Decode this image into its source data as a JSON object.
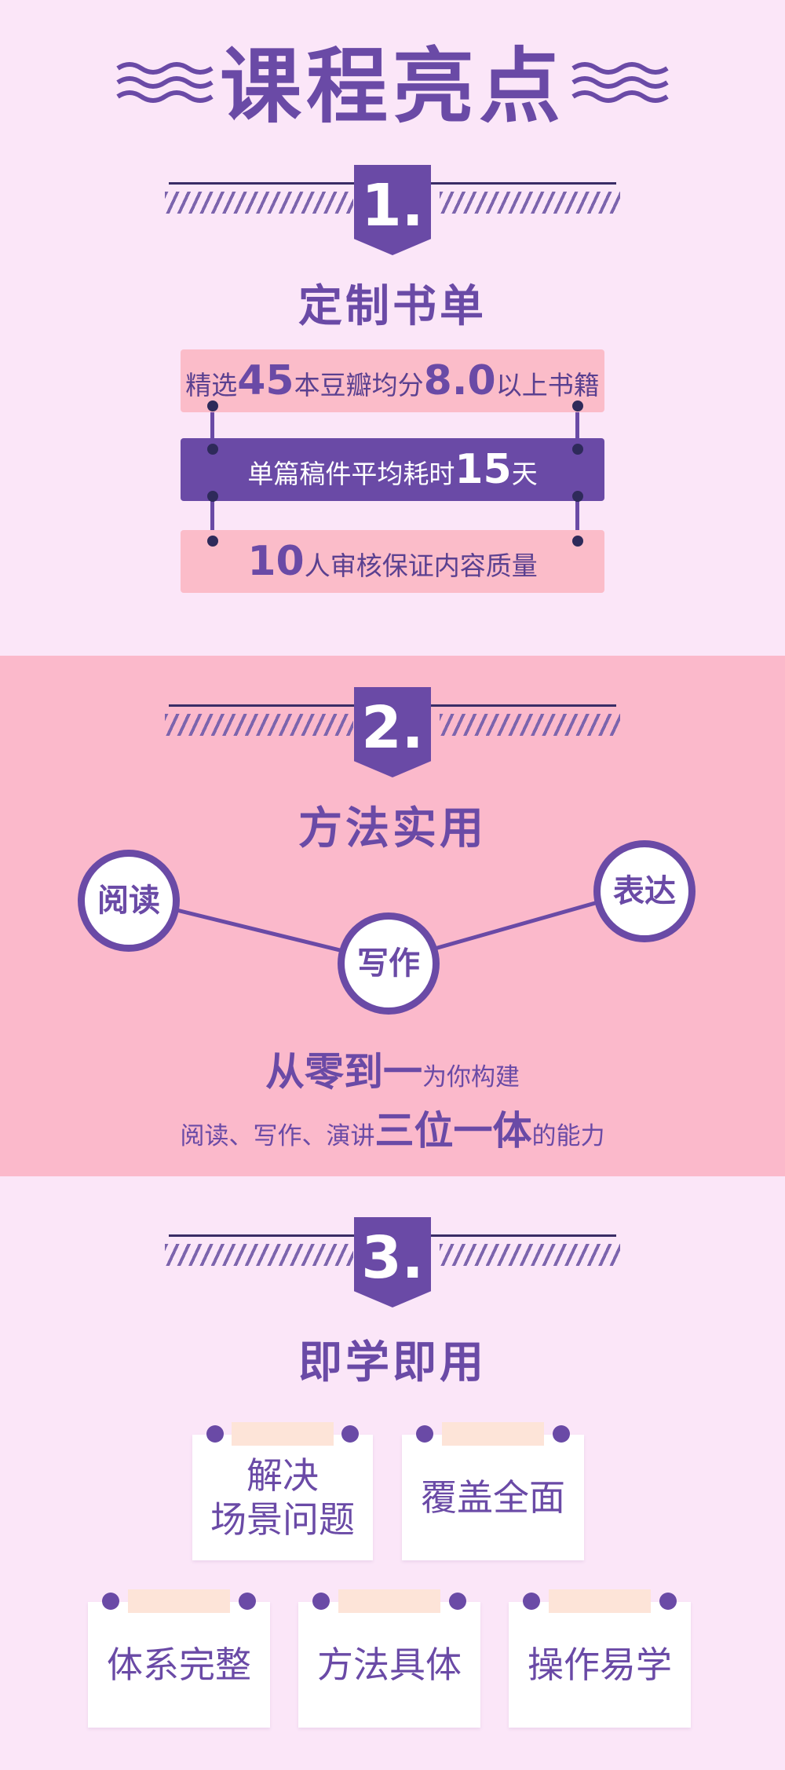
{
  "page_title": "课程亮点",
  "sections": [
    {
      "number": "1.",
      "title": "定制书单",
      "rows": [
        {
          "parts": [
            {
              "t": "精选"
            },
            {
              "t": "45",
              "big": true
            },
            {
              "t": "本豆瓣均分"
            },
            {
              "t": "8.0",
              "big": true
            },
            {
              "t": "以上书籍"
            }
          ]
        },
        {
          "parts": [
            {
              "t": "单篇稿件平均耗时"
            },
            {
              "t": "15",
              "big": true
            },
            {
              "t": "天"
            }
          ]
        },
        {
          "parts": [
            {
              "t": "10",
              "big": true
            },
            {
              "t": "人审核保证内容质量"
            }
          ]
        }
      ]
    },
    {
      "number": "2.",
      "title": "方法实用",
      "nodes": [
        "阅读",
        "写作",
        "表达"
      ],
      "tagline_line1": [
        {
          "t": "从零到一",
          "big": true
        },
        {
          "t": "为你构建"
        }
      ],
      "tagline_line2": [
        {
          "t": "阅读、写作、演讲"
        },
        {
          "t": "三位一体",
          "big": true
        },
        {
          "t": "的能力"
        }
      ]
    },
    {
      "number": "3.",
      "title": "即学即用",
      "cards": [
        "解决\n场景问题",
        "覆盖全面",
        "体系完整",
        "方法具体",
        "操作易学"
      ]
    }
  ],
  "colors": {
    "accent": "#6a4aa6",
    "pink_band": "#fbb9cb",
    "background": "#fbe6f8",
    "light_bar": "#fbbcc9"
  }
}
